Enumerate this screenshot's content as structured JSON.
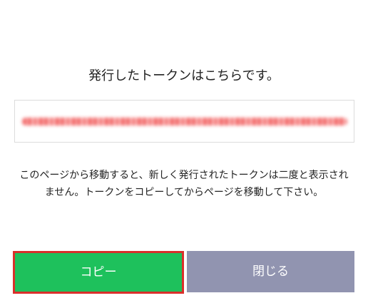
{
  "dialog": {
    "heading": "発行したトークンはこちらです。",
    "message": {
      "line1": "このページから移動すると、新しく発行されたトークンは二度と表示され",
      "line2": "ません。トークンをコピーしてからページを移動して下さい。"
    },
    "buttons": {
      "copy_label": "コピー",
      "close_label": "閉じる"
    }
  },
  "colors": {
    "copy_button": "#1ec15c",
    "copy_highlight": "#d9302b",
    "close_button": "#9194b0",
    "token_text": "#f25c5c"
  }
}
